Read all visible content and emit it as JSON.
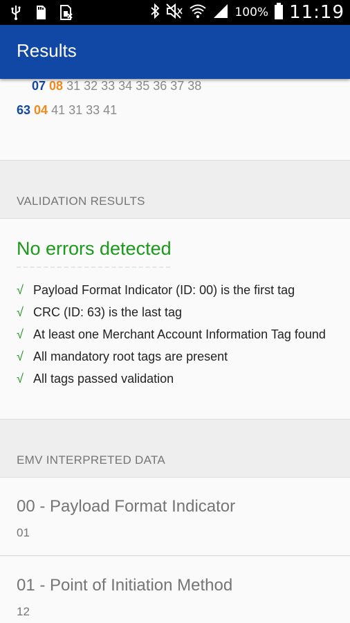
{
  "status_bar": {
    "icons_left": [
      "usb-icon",
      "sd-card-icon",
      "sim-card-icon"
    ],
    "icons_right": [
      "bluetooth-icon",
      "mute-icon",
      "wifi-icon",
      "signal-icon"
    ],
    "battery_pct": "100%",
    "clock": "11:19"
  },
  "app_bar": {
    "title": "Results"
  },
  "raw_data": {
    "line1": {
      "tag": "07",
      "len": "08",
      "value": "31 32 33 34 35 36 37 38"
    },
    "line2": {
      "tag": "63",
      "len": "04",
      "value": "41 31 33 41"
    }
  },
  "validation": {
    "header": "VALIDATION RESULTS",
    "status": "No errors detected",
    "check_mark": "√",
    "checks": [
      "Payload Format Indicator (ID: 00) is the first tag",
      "CRC (ID: 63) is the last tag",
      "At least one Merchant Account Information Tag found",
      "All mandatory root tags are present",
      "All tags passed validation"
    ]
  },
  "emv": {
    "header": "EMV INTERPRETED DATA",
    "items": [
      {
        "title": "00 - Payload Format Indicator",
        "value": "01"
      },
      {
        "title": "01 - Point of Initiation Method",
        "value": "12"
      }
    ]
  },
  "colors": {
    "app_bar": "#1147a5",
    "tag_id": "#1147a5",
    "tag_length": "#f08a1c",
    "success": "#1a9a1a"
  }
}
